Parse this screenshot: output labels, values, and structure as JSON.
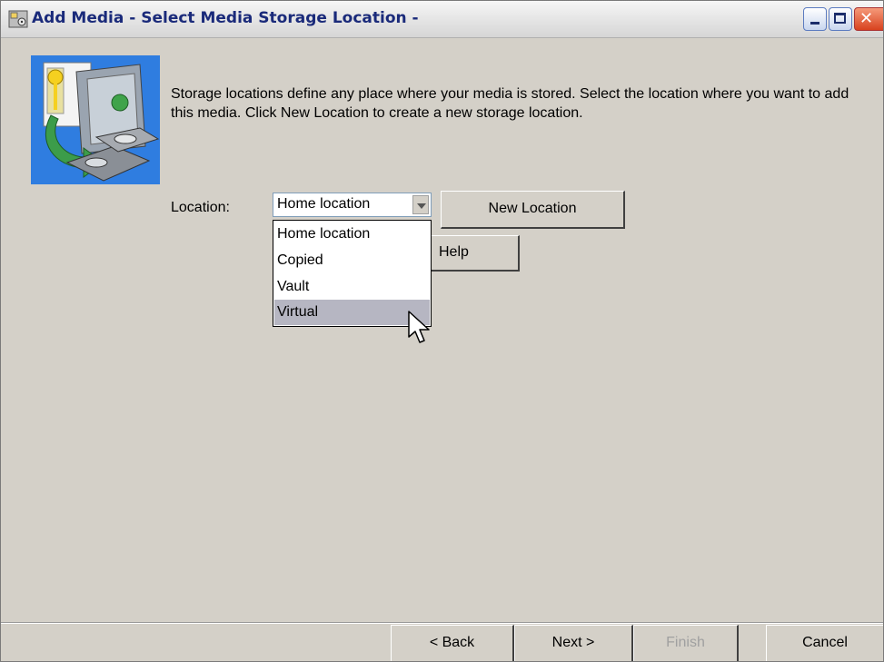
{
  "window": {
    "title": "Add Media - Select Media Storage Location -"
  },
  "main": {
    "description": "Storage locations define any place where your media is stored.  Select the location where you want to add this media.  Click New Location to create a new storage location.",
    "location_label": "Location:",
    "location_value": "Home location",
    "location_options": [
      "Home location",
      "Copied",
      "Vault",
      "Virtual"
    ],
    "highlighted_option": "Virtual",
    "new_location_label": "New Location",
    "help_label": "Help"
  },
  "footer": {
    "back_label": "< Back",
    "next_label": "Next >",
    "finish_label": "Finish",
    "cancel_label": "Cancel"
  },
  "colors": {
    "title_text": "#1a2a7a",
    "dialog_background": "#d4d0c8",
    "highlight": "#b6b6c2",
    "disabled_text": "#a0a0a0"
  },
  "icons": [
    "media-disk-icon",
    "storage-vault-icon",
    "minimize-icon",
    "maximize-icon",
    "close-icon",
    "dropdown-arrow-icon",
    "mouse-pointer-icon"
  ]
}
